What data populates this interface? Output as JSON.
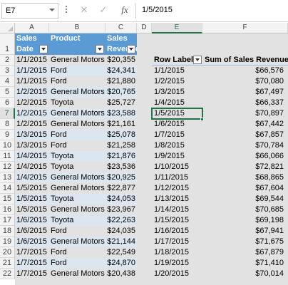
{
  "formula_bar": {
    "name_box": "E7",
    "cancel_icon": "✕",
    "enter_icon": "✓",
    "function_icon": "fx",
    "content": "1/5/2015"
  },
  "columns": [
    "A",
    "B",
    "C",
    "D",
    "E",
    "F"
  ],
  "rows": [
    "1",
    "2",
    "3",
    "4",
    "5",
    "6",
    "7",
    "8",
    "9",
    "10",
    "11",
    "12",
    "13",
    "14",
    "15",
    "16",
    "17",
    "18",
    "19",
    "20",
    "21",
    "22"
  ],
  "table": {
    "headers": {
      "date_line1": "Sales",
      "date_line2": "Date",
      "product": "Product",
      "revenue_line1": "Sales",
      "revenue_line2": "Revenue"
    },
    "rows": [
      [
        "1/1/2015",
        "General Motors",
        "$20,355"
      ],
      [
        "1/1/2015",
        "Ford",
        "$24,341"
      ],
      [
        "1/1/2015",
        "Ford",
        "$21,880"
      ],
      [
        "1/2/2015",
        "General Motors",
        "$20,765"
      ],
      [
        "1/2/2015",
        "Toyota",
        "$25,727"
      ],
      [
        "1/2/2015",
        "General Motors",
        "$23,588"
      ],
      [
        "1/2/2015",
        "General Motors",
        "$21,161"
      ],
      [
        "1/3/2015",
        "Ford",
        "$25,078"
      ],
      [
        "1/3/2015",
        "Ford",
        "$21,258"
      ],
      [
        "1/4/2015",
        "Toyota",
        "$21,876"
      ],
      [
        "1/4/2015",
        "Toyota",
        "$23,536"
      ],
      [
        "1/4/2015",
        "General Motors",
        "$20,925"
      ],
      [
        "1/5/2015",
        "General Motors",
        "$22,877"
      ],
      [
        "1/5/2015",
        "Toyota",
        "$24,053"
      ],
      [
        "1/5/2015",
        "General Motors",
        "$23,967"
      ],
      [
        "1/6/2015",
        "Toyota",
        "$22,263"
      ],
      [
        "1/6/2015",
        "Ford",
        "$24,035"
      ],
      [
        "1/6/2015",
        "General Motors",
        "$21,144"
      ],
      [
        "1/7/2015",
        "Ford",
        "$22,549"
      ],
      [
        "1/7/2015",
        "Ford",
        "$24,870"
      ],
      [
        "1/7/2015",
        "General Motors",
        "$20,438"
      ]
    ]
  },
  "pivot": {
    "row_labels_header": "Row Labels",
    "sum_header": "Sum of Sales Revenue",
    "rows": [
      [
        "1/1/2015",
        "$66,576"
      ],
      [
        "1/2/2015",
        "$70,080"
      ],
      [
        "1/3/2015",
        "$67,497"
      ],
      [
        "1/4/2015",
        "$66,337"
      ],
      [
        "1/5/2015",
        "$70,897"
      ],
      [
        "1/6/2015",
        "$67,442"
      ],
      [
        "1/7/2015",
        "$67,857"
      ],
      [
        "1/8/2015",
        "$70,784"
      ],
      [
        "1/9/2015",
        "$66,066"
      ],
      [
        "1/10/2015",
        "$72,821"
      ],
      [
        "1/11/2015",
        "$68,865"
      ],
      [
        "1/12/2015",
        "$67,604"
      ],
      [
        "1/13/2015",
        "$69,544"
      ],
      [
        "1/14/2015",
        "$70,685"
      ],
      [
        "1/15/2015",
        "$69,198"
      ],
      [
        "1/16/2015",
        "$67,941"
      ],
      [
        "1/17/2015",
        "$71,675"
      ],
      [
        "1/18/2015",
        "$67,879"
      ],
      [
        "1/19/2015",
        "$71,410"
      ],
      [
        "1/20/2015",
        "$70,014"
      ]
    ]
  },
  "colors": {
    "table_header": "#5b9bd5",
    "band": "#dce6f1",
    "selection": "#217346"
  }
}
